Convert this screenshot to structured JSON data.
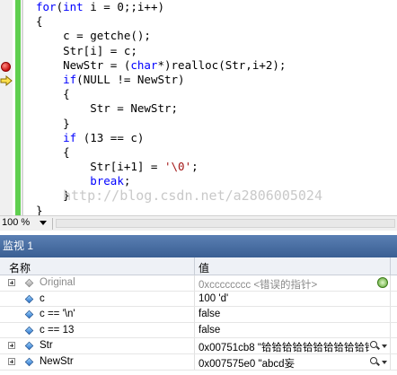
{
  "editor": {
    "watermark": "http://blog.csdn.net/a2806005024",
    "lines": [
      [
        {
          "t": "for",
          "c": "kw"
        },
        {
          "t": "(",
          "c": ""
        },
        {
          "t": "int",
          "c": "kw"
        },
        {
          "t": " i = 0;;i++)",
          "c": ""
        }
      ],
      [
        {
          "t": "{",
          "c": ""
        }
      ],
      [
        {
          "t": "    c = getche();",
          "c": ""
        }
      ],
      [
        {
          "t": "    Str[i] = c;",
          "c": ""
        }
      ],
      [
        {
          "t": "    NewStr = (",
          "c": ""
        },
        {
          "t": "char",
          "c": "kw"
        },
        {
          "t": "*)realloc(Str,i+2);",
          "c": ""
        }
      ],
      [
        {
          "t": "    ",
          "c": ""
        },
        {
          "t": "if",
          "c": "kw"
        },
        {
          "t": "(NULL != NewStr)",
          "c": ""
        }
      ],
      [
        {
          "t": "    {",
          "c": ""
        }
      ],
      [
        {
          "t": "        Str = NewStr;",
          "c": ""
        }
      ],
      [
        {
          "t": "    }",
          "c": ""
        }
      ],
      [
        {
          "t": "    ",
          "c": ""
        },
        {
          "t": "if",
          "c": "kw"
        },
        {
          "t": " (13 == c)",
          "c": ""
        }
      ],
      [
        {
          "t": "    {",
          "c": ""
        }
      ],
      [
        {
          "t": "        Str[i+1] = ",
          "c": ""
        },
        {
          "t": "'\\0'",
          "c": "str"
        },
        {
          "t": ";",
          "c": ""
        }
      ],
      [
        {
          "t": "        ",
          "c": ""
        },
        {
          "t": "break",
          "c": "kw"
        },
        {
          "t": ";",
          "c": ""
        }
      ],
      [
        {
          "t": "    }",
          "c": ""
        }
      ],
      [
        {
          "t": "}",
          "c": ""
        }
      ]
    ]
  },
  "zoom": {
    "value": "100 %"
  },
  "watch": {
    "title": "监视 1",
    "columns": {
      "name": "名称",
      "value": "值"
    },
    "rows": [
      {
        "name": "Original",
        "value": "0xcccccccc <错误的指针>",
        "expandable": true,
        "grey": true
      },
      {
        "name": "c",
        "value": "100 'd'",
        "expandable": false,
        "grey": false
      },
      {
        "name": "c == '\\n'",
        "value": "false",
        "expandable": false,
        "grey": false
      },
      {
        "name": "c == 13",
        "value": "false",
        "expandable": false,
        "grey": false
      },
      {
        "name": "Str",
        "value": "0x00751cb8 \"铪铪铪铪铪铪铪铪铪铪铪",
        "expandable": true,
        "grey": false
      },
      {
        "name": "NewStr",
        "value": "0x007575e0 \"abcd妄",
        "expandable": true,
        "grey": false
      }
    ]
  }
}
